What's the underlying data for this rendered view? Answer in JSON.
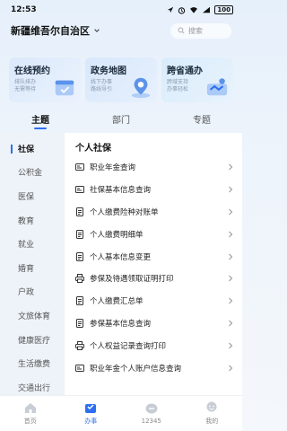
{
  "status": {
    "time": "12:53",
    "battery": "100"
  },
  "header": {
    "region": "新疆维吾尔自治区",
    "search_placeholder": "搜索"
  },
  "cards": [
    {
      "title": "在线预约",
      "subtitle": "排队排办\n无需等待"
    },
    {
      "title": "政务地图",
      "subtitle": "线下办事\n路线导引"
    },
    {
      "title": "跨省通办",
      "subtitle": "跨域支持\n办事轻松"
    }
  ],
  "tabs": [
    {
      "label": "主题"
    },
    {
      "label": "部门"
    },
    {
      "label": "专题"
    }
  ],
  "sidebar": {
    "items": [
      {
        "label": "社保"
      },
      {
        "label": "公积金"
      },
      {
        "label": "医保"
      },
      {
        "label": "教育"
      },
      {
        "label": "就业"
      },
      {
        "label": "婚育"
      },
      {
        "label": "户政"
      },
      {
        "label": "文旅体育"
      },
      {
        "label": "健康医疗"
      },
      {
        "label": "生活缴费"
      },
      {
        "label": "交通出行"
      }
    ]
  },
  "panel": {
    "title": "个人社保",
    "services": [
      {
        "label": "职业年金查询",
        "icon": "card-icon"
      },
      {
        "label": "社保基本信息查询",
        "icon": "card-icon"
      },
      {
        "label": "个人缴费险种对账单",
        "icon": "doc-icon"
      },
      {
        "label": "个人缴费明细单",
        "icon": "doc-icon"
      },
      {
        "label": "个人基本信息变更",
        "icon": "doc-icon"
      },
      {
        "label": "参保及待遇领取证明打印",
        "icon": "printer-icon"
      },
      {
        "label": "个人缴费汇总单",
        "icon": "doc-icon"
      },
      {
        "label": "参保基本信息查询",
        "icon": "doc-icon"
      },
      {
        "label": "个人权益记录查询打印",
        "icon": "printer-icon"
      },
      {
        "label": "职业年金个人账户信息查询",
        "icon": "card-icon"
      }
    ]
  },
  "bottom_nav": [
    {
      "label": "首页"
    },
    {
      "label": "办事"
    },
    {
      "label": "12345"
    },
    {
      "label": "我的"
    }
  ],
  "colors": {
    "accent": "#2d6ff0"
  }
}
